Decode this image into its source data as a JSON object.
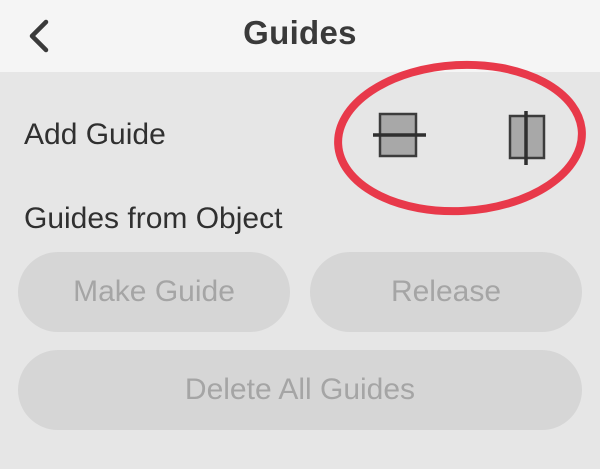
{
  "header": {
    "title": "Guides",
    "back_icon": "chevron-left-icon"
  },
  "add_guide": {
    "label": "Add Guide",
    "horizontal_icon": "horizontal-guide-icon",
    "vertical_icon": "vertical-guide-icon"
  },
  "guides_from_object": {
    "label": "Guides from Object",
    "make_guide_label": "Make Guide",
    "release_label": "Release",
    "delete_all_label": "Delete All Guides"
  },
  "colors": {
    "background": "#e6e6e6",
    "header_bg": "#f5f5f5",
    "button_bg": "#d6d6d6",
    "button_text_disabled": "#a5a5a5",
    "highlight": "#e8394a"
  }
}
